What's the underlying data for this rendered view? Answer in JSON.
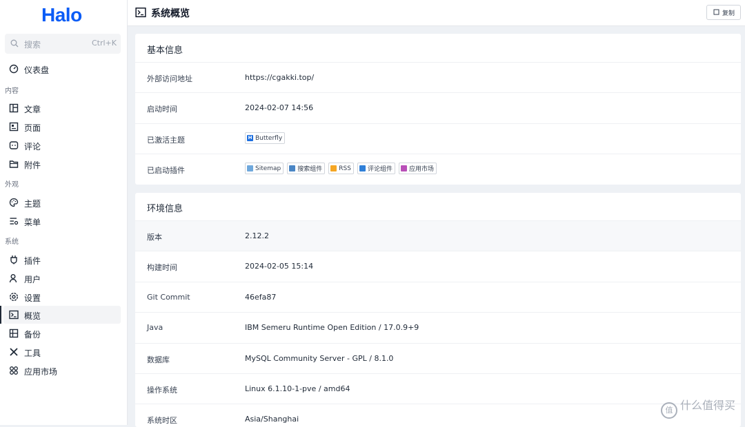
{
  "app": {
    "logo": "Halo"
  },
  "search": {
    "placeholder": "搜索",
    "shortcut": "Ctrl+K"
  },
  "sidebar": {
    "top": [
      {
        "label": "仪表盘",
        "icon": "dashboard-icon"
      }
    ],
    "groups": [
      {
        "label": "内容",
        "items": [
          {
            "label": "文章",
            "icon": "post-icon"
          },
          {
            "label": "页面",
            "icon": "page-icon"
          },
          {
            "label": "评论",
            "icon": "comment-icon"
          },
          {
            "label": "附件",
            "icon": "folder-icon"
          }
        ]
      },
      {
        "label": "外观",
        "items": [
          {
            "label": "主题",
            "icon": "palette-icon"
          },
          {
            "label": "菜单",
            "icon": "menu-icon"
          }
        ]
      },
      {
        "label": "系统",
        "items": [
          {
            "label": "插件",
            "icon": "plugin-icon"
          },
          {
            "label": "用户",
            "icon": "user-icon"
          },
          {
            "label": "设置",
            "icon": "settings-icon"
          },
          {
            "label": "概览",
            "icon": "terminal-icon",
            "active": true
          },
          {
            "label": "备份",
            "icon": "backup-icon"
          },
          {
            "label": "工具",
            "icon": "tools-icon"
          },
          {
            "label": "应用市场",
            "icon": "apps-icon"
          }
        ]
      }
    ]
  },
  "header": {
    "title": "系统概览",
    "copy_label": "复制"
  },
  "basic": {
    "title": "基本信息",
    "rows": [
      {
        "key": "外部访问地址",
        "value": "https://cgakki.top/"
      },
      {
        "key": "启动时间",
        "value": "2024-02-07 14:56"
      },
      {
        "key": "已激活主题",
        "tags": [
          {
            "label": "Butterfly",
            "color": "#1d6fe0",
            "glyph": "H"
          }
        ]
      },
      {
        "key": "已启动插件",
        "tags": [
          {
            "label": "Sitemap",
            "color": "#6fa8dc",
            "glyph": ""
          },
          {
            "label": "搜索组件",
            "color": "#4a86c5",
            "glyph": ""
          },
          {
            "label": "RSS",
            "color": "#f5a623",
            "glyph": ""
          },
          {
            "label": "评论组件",
            "color": "#2f7fd8",
            "glyph": ""
          },
          {
            "label": "应用市场",
            "color": "#b94fb8",
            "glyph": ""
          }
        ]
      }
    ]
  },
  "env": {
    "title": "环境信息",
    "rows": [
      {
        "key": "版本",
        "value": "2.12.2"
      },
      {
        "key": "构建时间",
        "value": "2024-02-05 15:14"
      },
      {
        "key": "Git Commit",
        "value": "46efa87"
      },
      {
        "key": "Java",
        "value": "IBM Semeru Runtime Open Edition / 17.0.9+9"
      },
      {
        "key": "数据库",
        "value": "MySQL Community Server - GPL / 8.1.0"
      },
      {
        "key": "操作系统",
        "value": "Linux 6.1.10-1-pve / amd64"
      },
      {
        "key": "系统时区",
        "value": "Asia/Shanghai"
      }
    ]
  },
  "watermark": {
    "text": "什么值得买",
    "glyph": "值"
  }
}
